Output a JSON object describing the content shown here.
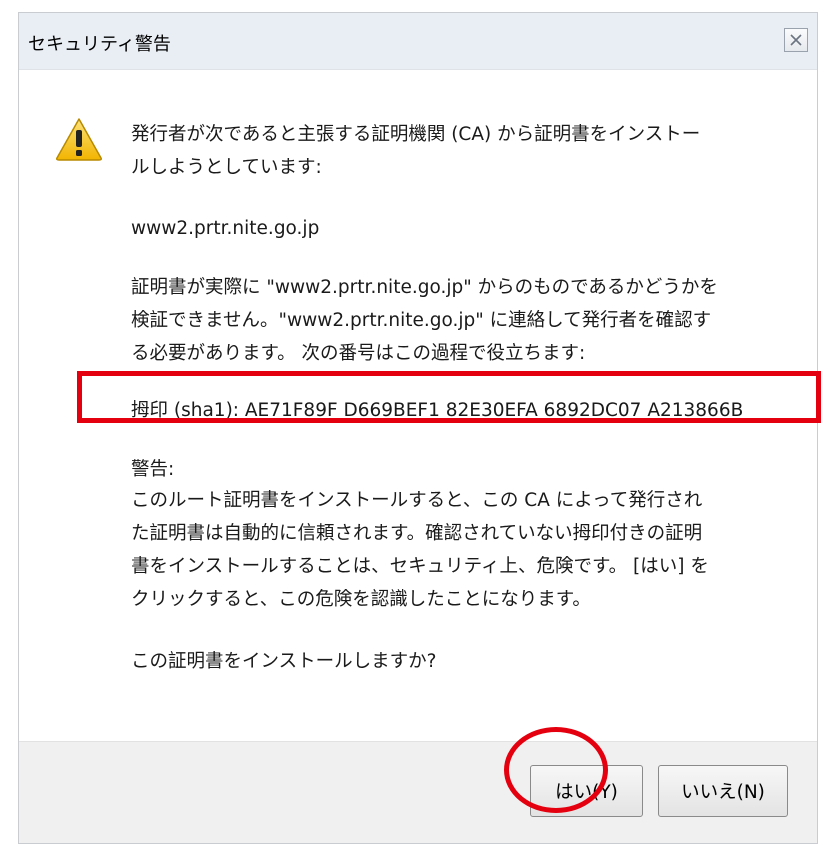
{
  "dialog": {
    "title": "セキュリティ警告",
    "close_icon": "close-icon",
    "warning_icon": "warning-triangle-icon"
  },
  "message": {
    "intro_line1": "発行者が次であると主張する証明機関 (CA) から証明書をインストー",
    "intro_line2": "ルしようとしています:",
    "issuer": "www2.prtr.nite.go.jp",
    "verify_line1": "証明書が実際に \"www2.prtr.nite.go.jp\" からのものであるかどうかを",
    "verify_line2": "検証できません。\"www2.prtr.nite.go.jp\" に連絡して発行者を確認す",
    "verify_line3": "る必要があります。 次の番号はこの過程で役立ちます:",
    "thumbprint": "拇印 (sha1): AE71F89F D669BEF1 82E30EFA 6892DC07 A213866B",
    "warning_heading": "警告:",
    "warning_line1": "このルート証明書をインストールすると、この CA によって発行され",
    "warning_line2": "た証明書は自動的に信頼されます。確認されていない拇印付きの証明",
    "warning_line3": "書をインストールすることは、セキュリティ上、危険です。 [はい] を",
    "warning_line4": "クリックすると、この危険を認識したことになります。",
    "question": "この証明書をインストールしますか?"
  },
  "buttons": {
    "yes_label": "はい(Y)",
    "no_label": "いいえ(N)"
  },
  "colors": {
    "annotation": "#e5000f",
    "titlebar": "#e9eef5",
    "footer": "#f0f0f0",
    "warning_yellow": "#f7c21a"
  }
}
